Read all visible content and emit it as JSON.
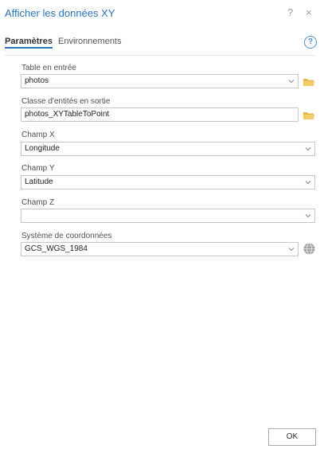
{
  "window": {
    "title": "Afficher les données XY",
    "help_symbol": "?",
    "close_symbol": "×"
  },
  "tabs": [
    {
      "label": "Paramètres",
      "active": true
    },
    {
      "label": "Environnements",
      "active": false
    }
  ],
  "help_icon": {
    "glyph": "?"
  },
  "params": {
    "input_table": {
      "label": "Table en entrée",
      "value": "photos"
    },
    "output_class": {
      "label": "Classe d'entités en sortie",
      "value": "photos_XYTableToPoint"
    },
    "field_x": {
      "label": "Champ X",
      "value": "Longitude"
    },
    "field_y": {
      "label": "Champ Y",
      "value": "Latitude"
    },
    "field_z": {
      "label": "Champ Z",
      "value": ""
    },
    "coord_system": {
      "label": "Système de coordonnées",
      "value": "GCS_WGS_1984"
    }
  },
  "ok_button": {
    "label": "OK"
  },
  "colors": {
    "title": "#2b74c1",
    "accent": "#4a90d9",
    "folder": "#e8b84a",
    "border": "#c7c7c7"
  }
}
